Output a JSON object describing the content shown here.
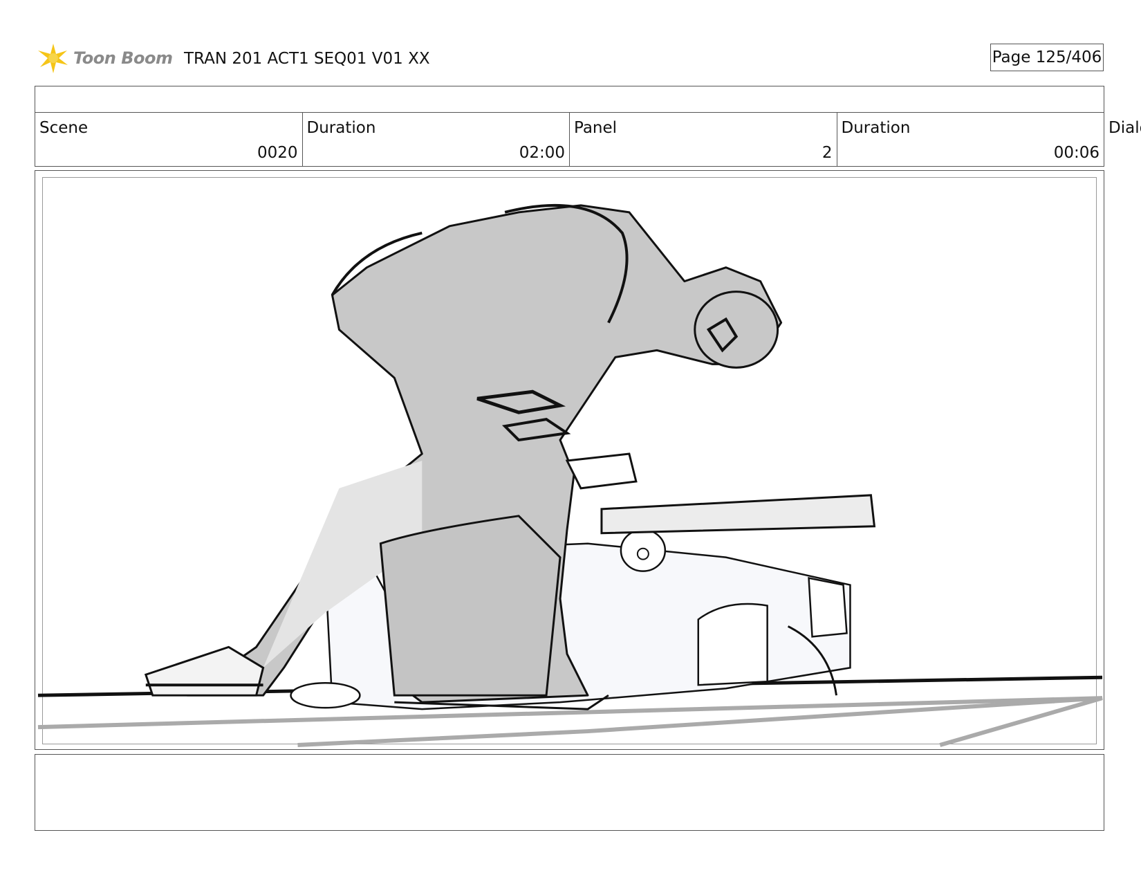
{
  "header": {
    "logo_text": "Toon Boom",
    "title": "TRAN 201 ACT1 SEQ01 V01 XX",
    "page": "Page 125/406"
  },
  "info": {
    "scene_label": "Scene",
    "scene_value": "0020",
    "scene_duration_label": "Duration",
    "scene_duration_value": "02:00",
    "panel_label": "Panel",
    "panel_value": "2",
    "panel_duration_label": "Duration",
    "panel_duration_value": "00:06",
    "dialog_label": "Dialog"
  },
  "colors": {
    "logo_star": "#f5c518",
    "sketch_fill": "#c8c8c8",
    "sketch_light": "#e6e6e6",
    "ink": "#111111"
  }
}
